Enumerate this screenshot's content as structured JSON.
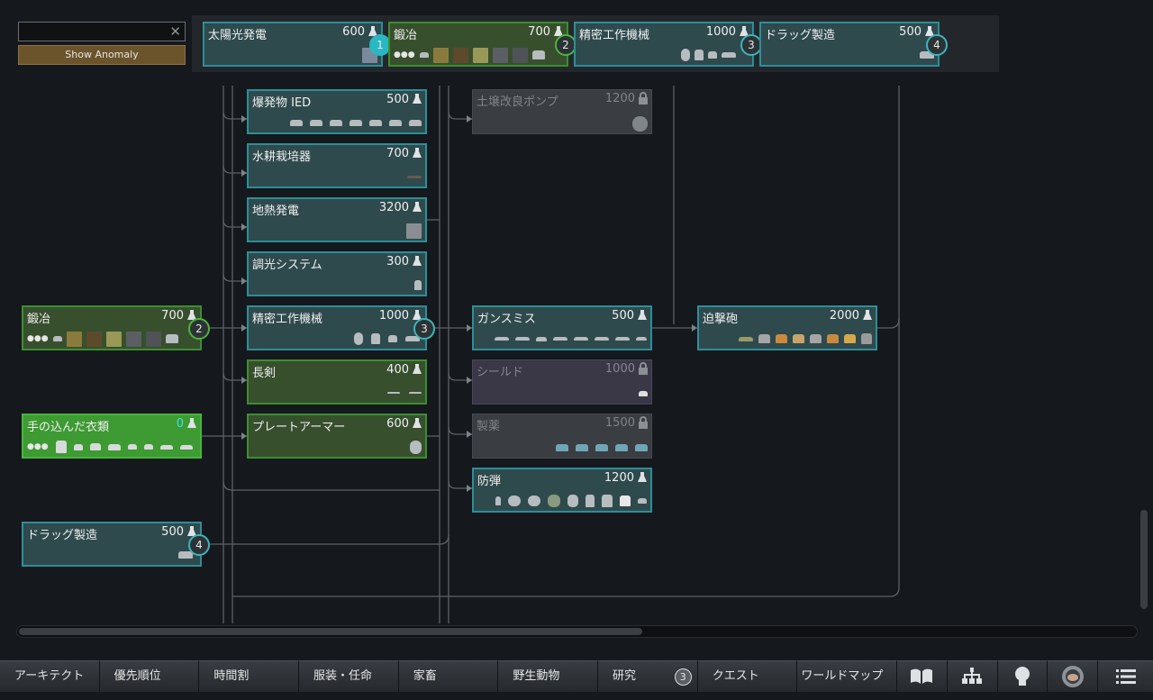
{
  "search": {
    "value": "",
    "placeholder": ""
  },
  "anomaly_button": "Show Anomaly",
  "queue": [
    {
      "title": "太陽光発電",
      "cost": "600",
      "num": "1"
    },
    {
      "title": "鍛冶",
      "cost": "700",
      "num": "2"
    },
    {
      "title": "精密工作機械",
      "cost": "1000",
      "num": "3"
    },
    {
      "title": "ドラッグ製造",
      "cost": "500",
      "num": "4"
    }
  ],
  "tree": {
    "smithing": {
      "title": "鍛冶",
      "cost": "700",
      "num": "2",
      "dots": "●●●"
    },
    "complex_clothing": {
      "title": "手の込んだ衣類",
      "cost": "0",
      "dots": "●●●"
    },
    "drug_production": {
      "title": "ドラッグ製造",
      "cost": "500",
      "num": "4"
    },
    "ied": {
      "title": "爆発物 IED",
      "cost": "500"
    },
    "hydroponics": {
      "title": "水耕栽培器",
      "cost": "700"
    },
    "geothermal": {
      "title": "地熱発電",
      "cost": "3200"
    },
    "colored_lights": {
      "title": "調光システム",
      "cost": "300"
    },
    "machining": {
      "title": "精密工作機械",
      "cost": "1000",
      "num": "3"
    },
    "long_blades": {
      "title": "長剣",
      "cost": "400"
    },
    "plate_armor": {
      "title": "プレートアーマー",
      "cost": "600"
    },
    "soil_pump": {
      "title": "土壌改良ポンプ",
      "cost": "1200"
    },
    "gunsmithing": {
      "title": "ガンスミス",
      "cost": "500"
    },
    "shields": {
      "title": "シールド",
      "cost": "1000"
    },
    "medicine": {
      "title": "製薬",
      "cost": "1500"
    },
    "flak_armor": {
      "title": "防弾",
      "cost": "1200"
    },
    "mortars": {
      "title": "迫撃砲",
      "cost": "2000"
    }
  },
  "tabs": [
    {
      "label": "アーキテクト"
    },
    {
      "label": "優先順位"
    },
    {
      "label": "時間割"
    },
    {
      "label": "服装・任命"
    },
    {
      "label": "家畜"
    },
    {
      "label": "野生動物"
    },
    {
      "label": "研究",
      "badge": "3"
    },
    {
      "label": "クエスト"
    },
    {
      "label": "ワールドマップ"
    }
  ],
  "tab_icons": [
    "book-icon",
    "factions-icon",
    "lightbulb-icon",
    "colonist-helmet-icon",
    "menu-icon"
  ],
  "colors": {
    "available_border": "#2d8e98",
    "completed_border": "#3a8f2f",
    "badge_accent": "#3fb3bd",
    "swatch_1": "#8a7b3c",
    "swatch_2": "#5d4a2a",
    "swatch_3": "#9a9856",
    "swatch_4": "#5b5f63"
  }
}
